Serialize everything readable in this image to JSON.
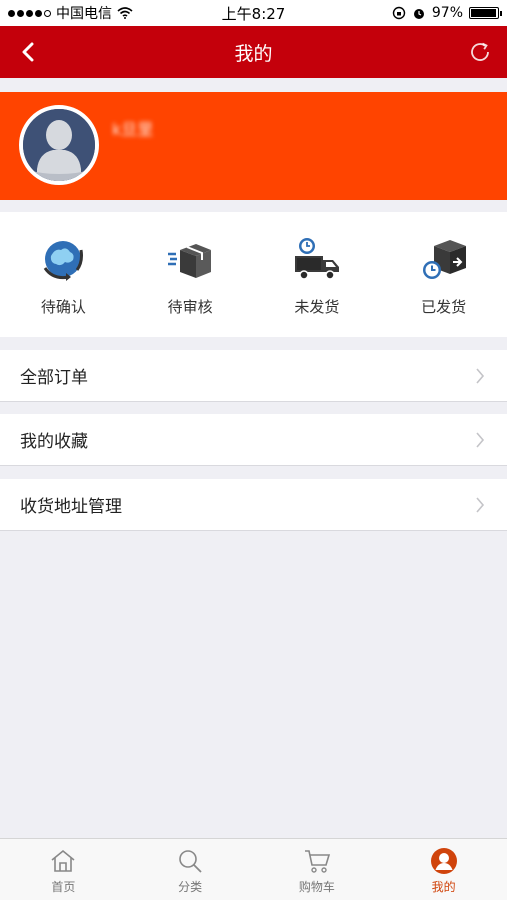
{
  "status_bar": {
    "carrier": "中国电信",
    "time": "上午8:27",
    "battery": "97%",
    "battery_level": 0.97
  },
  "nav": {
    "title": "我的",
    "back_icon": "chevron-left-icon",
    "refresh_icon": "refresh-icon"
  },
  "profile": {
    "username": "k旦里",
    "avatar_icon": "user-silhouette-icon"
  },
  "order_status": [
    {
      "label": "待确认",
      "icon": "globe-cycle-icon"
    },
    {
      "label": "待审核",
      "icon": "box-fast-icon"
    },
    {
      "label": "未发货",
      "icon": "truck-clock-icon"
    },
    {
      "label": "已发货",
      "icon": "box-shipped-icon"
    }
  ],
  "menu": [
    {
      "label": "全部订单"
    },
    {
      "label": "我的收藏"
    },
    {
      "label": "收货地址管理"
    }
  ],
  "tabs": [
    {
      "label": "首页",
      "icon": "home-icon"
    },
    {
      "label": "分类",
      "icon": "search-icon"
    },
    {
      "label": "购物车",
      "icon": "cart-icon"
    },
    {
      "label": "我的",
      "icon": "user-icon",
      "active": true
    }
  ],
  "colors": {
    "nav_bg": "#c4000b",
    "profile_bg": "#ff4400",
    "tab_active": "#d0440c"
  }
}
